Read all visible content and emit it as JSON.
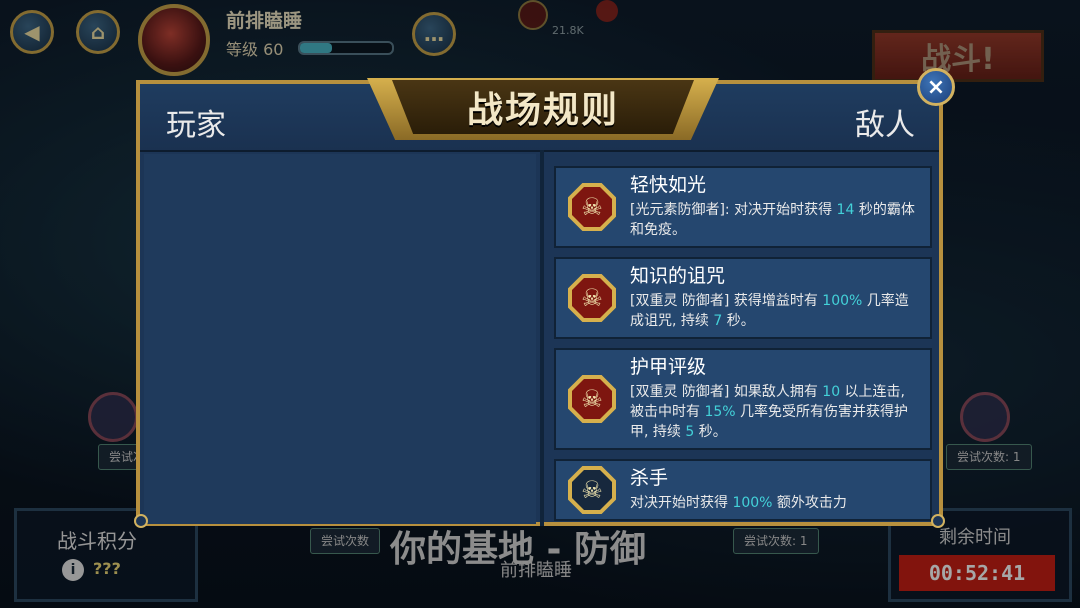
{
  "header": {
    "player_name": "前排瞌睡",
    "level_label": "等级",
    "level_value": "60",
    "xp_progress": 0.35,
    "power_label": "21.8K"
  },
  "fight_button": {
    "label": "战斗!"
  },
  "modal": {
    "title": "战场规则",
    "left_header": "玩家",
    "right_header": "敌人",
    "close_icon": "×",
    "enemy_rules": [
      {
        "title": "轻快如光",
        "desc_parts": [
          "[光元素防御者]: 对决开始时获得 ",
          "14",
          " 秒的霸体和免疫。"
        ],
        "icon_style": "red"
      },
      {
        "title": "知识的诅咒",
        "desc_parts": [
          "[双重灵 防御者] 获得增益时有 ",
          "100%",
          " 几率造成诅咒, 持续 ",
          "7",
          " 秒。"
        ],
        "icon_style": "red"
      },
      {
        "title": "护甲评级",
        "desc_parts": [
          "[双重灵 防御者] 如果敌人拥有 ",
          "10",
          " 以上连击, 被击中时有 ",
          "15%",
          " 几率免受所有伤害并获得护甲, 持续 ",
          "5",
          " 秒。"
        ],
        "icon_style": "red"
      },
      {
        "title": "杀手",
        "desc_parts": [
          "对决开始时获得 ",
          "100%",
          " 额外攻击力"
        ],
        "icon_style": "dark"
      }
    ]
  },
  "bottom": {
    "score_label": "战斗积分",
    "score_value": "???",
    "time_label": "剩余时间",
    "time_value": "00:52:41",
    "base_title": "你的基地 - 防御",
    "base_subtitle": "前排瞌睡",
    "try_label": "尝试次数",
    "try_label_left": "尝试次",
    "try_right": "尝试次数: 1",
    "try_center_right": "尝试次数: 1"
  }
}
